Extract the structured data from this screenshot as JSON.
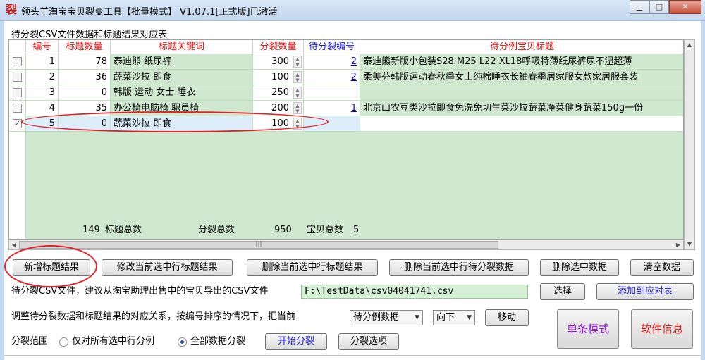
{
  "window": {
    "icon": "裂",
    "title": "领头羊淘宝宝贝裂变工具【批量模式】 V1.07.1[正式版]已激活",
    "min": "▁",
    "max": "□",
    "close": "✕"
  },
  "section_label": "待分裂CSV文件数据和标题结果对应表",
  "table": {
    "headers": [
      "编号",
      "标题数量",
      "标题关键词",
      "分裂数量",
      "待分裂编号",
      "待分例宝贝标题"
    ],
    "rows": [
      {
        "checked": false,
        "check": "",
        "no": "1",
        "title_count": "78",
        "keywords": "泰迪熊 纸尿裤",
        "split_count": "300",
        "split_no": "2",
        "product_title": "泰迪熊新版小包装S28 M25 L22 XL18呼吸特薄纸尿裤尿不湿超薄"
      },
      {
        "checked": false,
        "check": "",
        "no": "2",
        "title_count": "36",
        "keywords": "蔬菜沙拉 即食",
        "split_count": "100",
        "split_no": "2",
        "product_title": "柔美芬韩版运动春秋季女士纯棉睡衣长袖春季居家服女款家居服套装"
      },
      {
        "checked": false,
        "check": "",
        "no": "3",
        "title_count": "0",
        "keywords": "韩版 运动 女士 睡衣",
        "split_count": "250",
        "split_no": "",
        "product_title": ""
      },
      {
        "checked": false,
        "check": "",
        "no": "4",
        "title_count": "35",
        "keywords": "办公椅电脑椅 职员椅",
        "split_count": "200",
        "split_no": "1",
        "product_title": "北京山农豆类沙拉即食免洗免切生菜沙拉蔬菜净菜健身蔬菜150g一份"
      },
      {
        "checked": true,
        "check": "✓",
        "no": "5",
        "title_count": "0",
        "keywords": "蔬菜沙拉 即食",
        "split_count": "100",
        "split_no": "",
        "product_title": ""
      }
    ],
    "summary": {
      "total_titles": "149",
      "total_titles_label": "标题总数",
      "split_total_label": "分裂总数",
      "split_total": "950",
      "items_label": "宝贝总数",
      "items_total": "5"
    }
  },
  "buttons": {
    "add": "新增标题结果",
    "modify": "修改当前选中行标题结果",
    "delete_title": "删除当前选中行标题结果",
    "delete_split": "删除当前选中行待分裂数据",
    "delete_selected": "删除选中数据",
    "clear": "清空数据",
    "choose": "选择",
    "add_to_table": "添加到应对表",
    "move": "移动",
    "start": "开始分裂",
    "options": "分裂选项",
    "single_mode": "单条模式",
    "software_info": "软件信息"
  },
  "csv": {
    "label": "待分裂CSV文件，建议从淘宝助理出售中的宝贝导出的CSV文件",
    "path": "F:\\TestData\\csv04041741.csv"
  },
  "adjust": {
    "label": "调整待分裂数据和标题结果的对应关系，按编号排序的情况下，把当前",
    "target": "待分例数据",
    "direction": "向下"
  },
  "scope": {
    "label": "分裂范围",
    "option_selected": "仅对所有选中行分例",
    "option_all": "全部数据分裂",
    "selected_value": "全部数据分裂"
  },
  "colors": {
    "grid_green": "#cfe8cf",
    "header_red": "#e81010",
    "header_blue": "#1111d8",
    "annotation_red": "#e8202a",
    "single_mode_purple": "#8a18c8",
    "software_info_red": "#e01818"
  }
}
